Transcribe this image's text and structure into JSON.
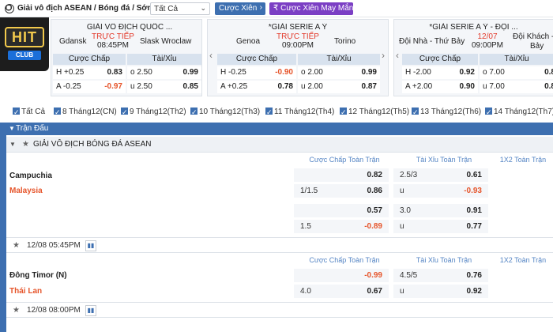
{
  "topbar": {
    "breadcrumb": "Giải vô địch ASEAN / Bóng đá / Sớm",
    "filter_value": "Tất Cả",
    "btn_xien": "Cược Xiên",
    "btn_xien_may_man": "Cược Xiên May Mắn"
  },
  "logo": {
    "text": "HIT",
    "sub": "CLUB"
  },
  "cards": [
    {
      "league": "GIẢI VÔ ĐỊCH QUỐC ...",
      "home": "Gdansk",
      "away": "Slask Wroclaw",
      "status": "TRỰC TIẾP",
      "time": "08:45PM",
      "head_handicap": "Cược Chấp",
      "head_total": "Tài/Xỉu",
      "rows": [
        {
          "h_label": "H +0.25",
          "h_val": "0.83",
          "t_label": "o 2.50",
          "t_val": "0.99"
        },
        {
          "h_label": "A -0.25",
          "h_val": "-0.97",
          "t_label": "u 2.50",
          "t_val": "0.85"
        }
      ]
    },
    {
      "league": "*GIẢI SERIE A Ý",
      "home": "Genoa",
      "away": "Torino",
      "status": "TRỰC TIẾP",
      "time": "09:00PM",
      "head_handicap": "Cược Chấp",
      "head_total": "Tài/Xỉu",
      "rows": [
        {
          "h_label": "H -0.25",
          "h_val": "-0.90",
          "t_label": "o 2.00",
          "t_val": "0.99"
        },
        {
          "h_label": "A +0.25",
          "h_val": "0.78",
          "t_label": "u 2.00",
          "t_val": "0.87"
        }
      ]
    },
    {
      "league": "*GIẢI SERIE A Ý - ĐỘI ...",
      "home": "Đội Nhà - Thứ Bảy",
      "away_line1": "Đội Khách - T",
      "away_line2": "Bảy",
      "status": "12/07",
      "time": "09:00PM",
      "head_handicap": "Cược Chấp",
      "head_total": "Tài/Xỉu",
      "rows": [
        {
          "h_label": "H -2.00",
          "h_val": "0.92",
          "t_label": "o 7.00",
          "t_val": "0.8"
        },
        {
          "h_label": "A +2.00",
          "h_val": "0.90",
          "t_label": "u 7.00",
          "t_val": "0.8"
        }
      ]
    }
  ],
  "tabs": [
    "Tất Cả",
    "8 Tháng12(CN)",
    "9 Tháng12(Th2)",
    "10 Tháng12(Th3)",
    "11 Tháng12(Th4)",
    "12 Tháng12(Th5)",
    "13 Tháng12(Th6)",
    "14 Tháng12(Th7)"
  ],
  "section": {
    "title": "Trận Đấu",
    "league": "GIẢI VÔ ĐỊCH BÓNG ĐÁ ASEAN"
  },
  "columns": {
    "handicap": "Cược Chấp Toàn Trận",
    "total": "Tài Xỉu Toàn Trận",
    "onextwo": "1X2 Toàn Trận"
  },
  "matches": [
    {
      "home": "Campuchia",
      "away": "Malaysia",
      "datetime": "12/08 05:45PM",
      "lines": [
        {
          "hc_label": "",
          "hc_val": "0.82",
          "tt_label": "2.5/3",
          "tt_val": "0.61"
        },
        {
          "hc_label": "1/1.5",
          "hc_val": "0.86",
          "tt_label": "u",
          "tt_val": "-0.93"
        },
        {
          "hc_label": "",
          "hc_val": "0.57",
          "tt_label": "3.0",
          "tt_val": "0.91"
        },
        {
          "hc_label": "1.5",
          "hc_val": "-0.89",
          "tt_label": "u",
          "tt_val": "0.77"
        }
      ]
    },
    {
      "home": "Đông Timor (N)",
      "away": "Thái Lan",
      "datetime": "12/08 08:00PM",
      "lines": [
        {
          "hc_label": "",
          "hc_val": "-0.99",
          "tt_label": "4.5/5",
          "tt_val": "0.76"
        },
        {
          "hc_label": "4.0",
          "hc_val": "0.67",
          "tt_label": "u",
          "tt_val": "0.92"
        }
      ]
    }
  ],
  "colors": {
    "primary": "#3d6fb0",
    "accent_purple": "#7b3fc4",
    "negative": "#e6552b",
    "live": "#e33b2c"
  }
}
